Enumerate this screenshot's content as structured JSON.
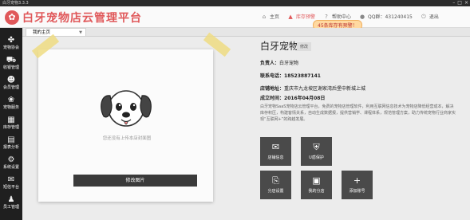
{
  "titlebar": {
    "title": "白牙宠物3.3.3"
  },
  "header": {
    "logo_text": "白牙宠物店云管理平台"
  },
  "topnav": {
    "home": "主页",
    "stock_warning": "库存预警",
    "help": "帮助中心",
    "qq": "QQ群：431240415",
    "exit": "退出"
  },
  "tip": "45条库存有预警！",
  "tab": {
    "label": "我的主页"
  },
  "sidebar": [
    {
      "label": "宠物协会",
      "icon": "paw-icon"
    },
    {
      "label": "收银管理",
      "icon": "cart-icon"
    },
    {
      "label": "会员管理",
      "icon": "user-icon"
    },
    {
      "label": "宠物服务",
      "icon": "dog-icon"
    },
    {
      "label": "库存管理",
      "icon": "box-icon"
    },
    {
      "label": "报表分析",
      "icon": "chart-icon"
    },
    {
      "label": "系统设置",
      "icon": "gear-icon"
    },
    {
      "label": "短信平台",
      "icon": "sms-icon"
    },
    {
      "label": "员工管理",
      "icon": "staff-icon"
    }
  ],
  "photo": {
    "empty_text": "您还没有上传本店封面图",
    "edit_label": "修改图片"
  },
  "shop": {
    "name": "白牙宠物",
    "edit_tag": "修改",
    "owner_label": "负责人：",
    "owner": "白牙宠物",
    "phone_label": "联系电话：",
    "phone": "18523887141",
    "address_label": "店铺地址：",
    "address": "重庆市九龙坡区谢家湾后堡中新城上城",
    "founded_label": "成立时间：",
    "founded": "2016年04月08日",
    "description": "白牙宠物SaaS宠物店云管理平台，免费的宠物店管理软件，利用互联网信息技术为宠物店降低经营成本，解决库存积压，构建客情关系，自动生成数据报，提供营销学、课程体系，规范管理方案，助力传统宠物行业商家实现“互联网+”的跨越发展。"
  },
  "tiles": [
    {
      "label": "店铺信息",
      "icon": "chat-icon"
    },
    {
      "label": "U盾保护",
      "icon": "shield-icon"
    },
    {
      "label": "分店设置",
      "icon": "branch-icon"
    },
    {
      "label": "我的分店",
      "icon": "store-icon"
    },
    {
      "label": "添加账号",
      "icon": "plus-icon"
    }
  ],
  "colors": {
    "brand": "#e0585a",
    "sidebar": "#1f1f1f",
    "tile": "#4a4a4a"
  }
}
